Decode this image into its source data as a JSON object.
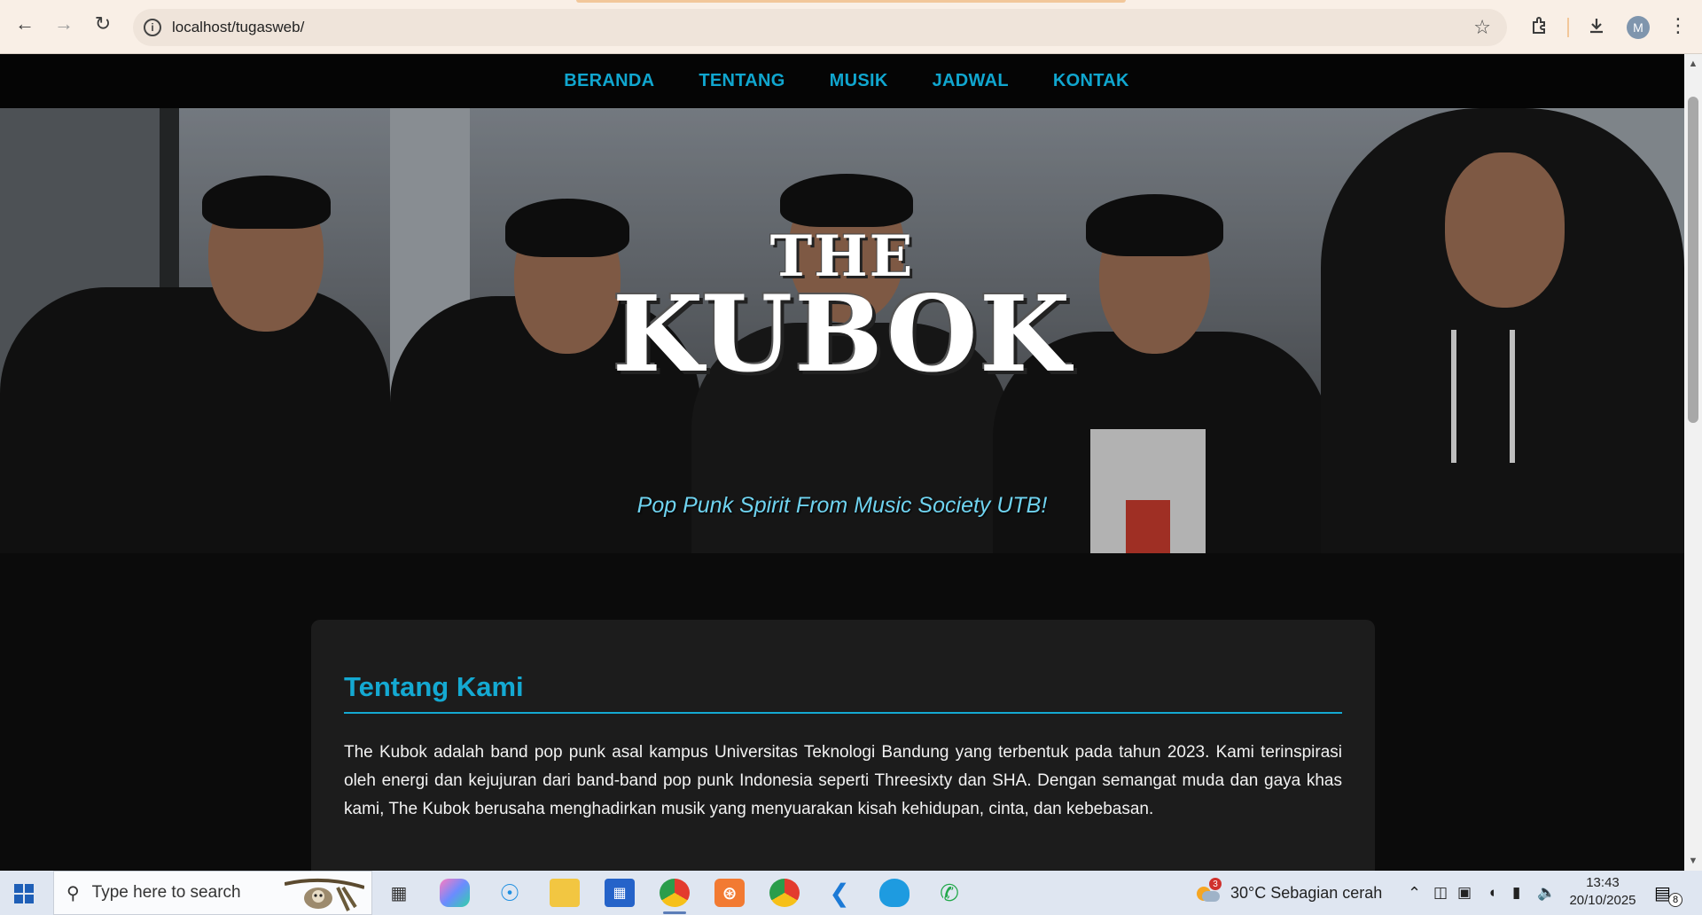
{
  "browser": {
    "url": "localhost/tugasweb/",
    "profile_initial": "M"
  },
  "nav": {
    "items": [
      "BERANDA",
      "TENTANG",
      "MUSIK",
      "JADWAL",
      "KONTAK"
    ]
  },
  "hero": {
    "logo_the": "THE",
    "logo_name": "KUBOK",
    "tagline": "Pop Punk Spirit From Music Society UTB!"
  },
  "about": {
    "title": "Tentang Kami",
    "text": "The Kubok adalah band pop punk asal kampus Universitas Teknologi Bandung yang terbentuk pada tahun 2023. Kami terinspirasi oleh energi dan kejujuran dari band-band pop punk Indonesia seperti Threesixty dan SHA. Dengan semangat muda dan gaya khas kami, The Kubok berusaha menghadirkan musik yang menyuarakan kisah kehidupan, cinta, dan kebebasan."
  },
  "taskbar": {
    "search_placeholder": "Type here to search",
    "weather_badge": "3",
    "weather": "30°C  Sebagian cerah",
    "time": "13:43",
    "date": "20/10/2025",
    "notification_count": "8"
  },
  "colors": {
    "accent": "#14a9d2",
    "nav_bg": "#050505",
    "page_bg": "#0b0b0b",
    "card_bg": "#1c1c1c",
    "tagline": "#6fd3f0"
  }
}
